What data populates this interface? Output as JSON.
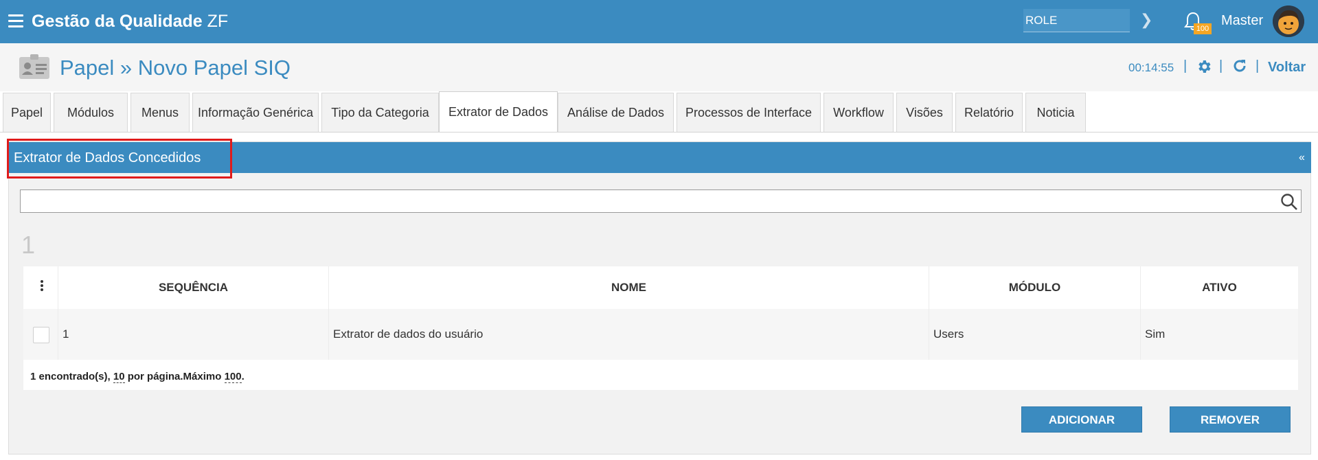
{
  "topbar": {
    "app_title": "Gestão da Qualidade",
    "app_title_suffix": "ZF",
    "role_value": "ROLE",
    "notification_count": "100",
    "user_name": "Master"
  },
  "header": {
    "page_title": "Papel » Novo Papel SIQ",
    "timer": "00:14:55",
    "separator": "|",
    "back_label": "Voltar"
  },
  "tabs": [
    {
      "label": "Papel"
    },
    {
      "label": "Módulos"
    },
    {
      "label": "Menus"
    },
    {
      "label": "Informação Genérica"
    },
    {
      "label": "Tipo da Categoria"
    },
    {
      "label": "Extrator de Dados"
    },
    {
      "label": "Análise de Dados"
    },
    {
      "label": "Processos de Interface"
    },
    {
      "label": "Workflow"
    },
    {
      "label": "Visões"
    },
    {
      "label": "Relatório"
    },
    {
      "label": "Noticia"
    }
  ],
  "active_tab": "Extrator de Dados",
  "panel": {
    "title": "Extrator de Dados Concedidos",
    "collapse_symbol": "«",
    "search_value": "",
    "page_number": "1"
  },
  "table": {
    "columns": [
      "SEQUÊNCIA",
      "NOME",
      "MÓDULO",
      "ATIVO"
    ],
    "rows": [
      {
        "sequencia": "1",
        "nome": "Extrator de dados do usuário",
        "modulo": "Users",
        "ativo": "Sim"
      }
    ],
    "footer": {
      "found": "1 encontrado(s),",
      "per_page_value": "10",
      "per_page_text": "por página.Máximo",
      "max_value": "100",
      "end": "."
    }
  },
  "buttons": {
    "add": "ADICIONAR",
    "remove": "REMOVER"
  },
  "colors": {
    "primary": "#3b8bc0",
    "badge": "#f5a623",
    "highlight": "#e01b1b"
  }
}
